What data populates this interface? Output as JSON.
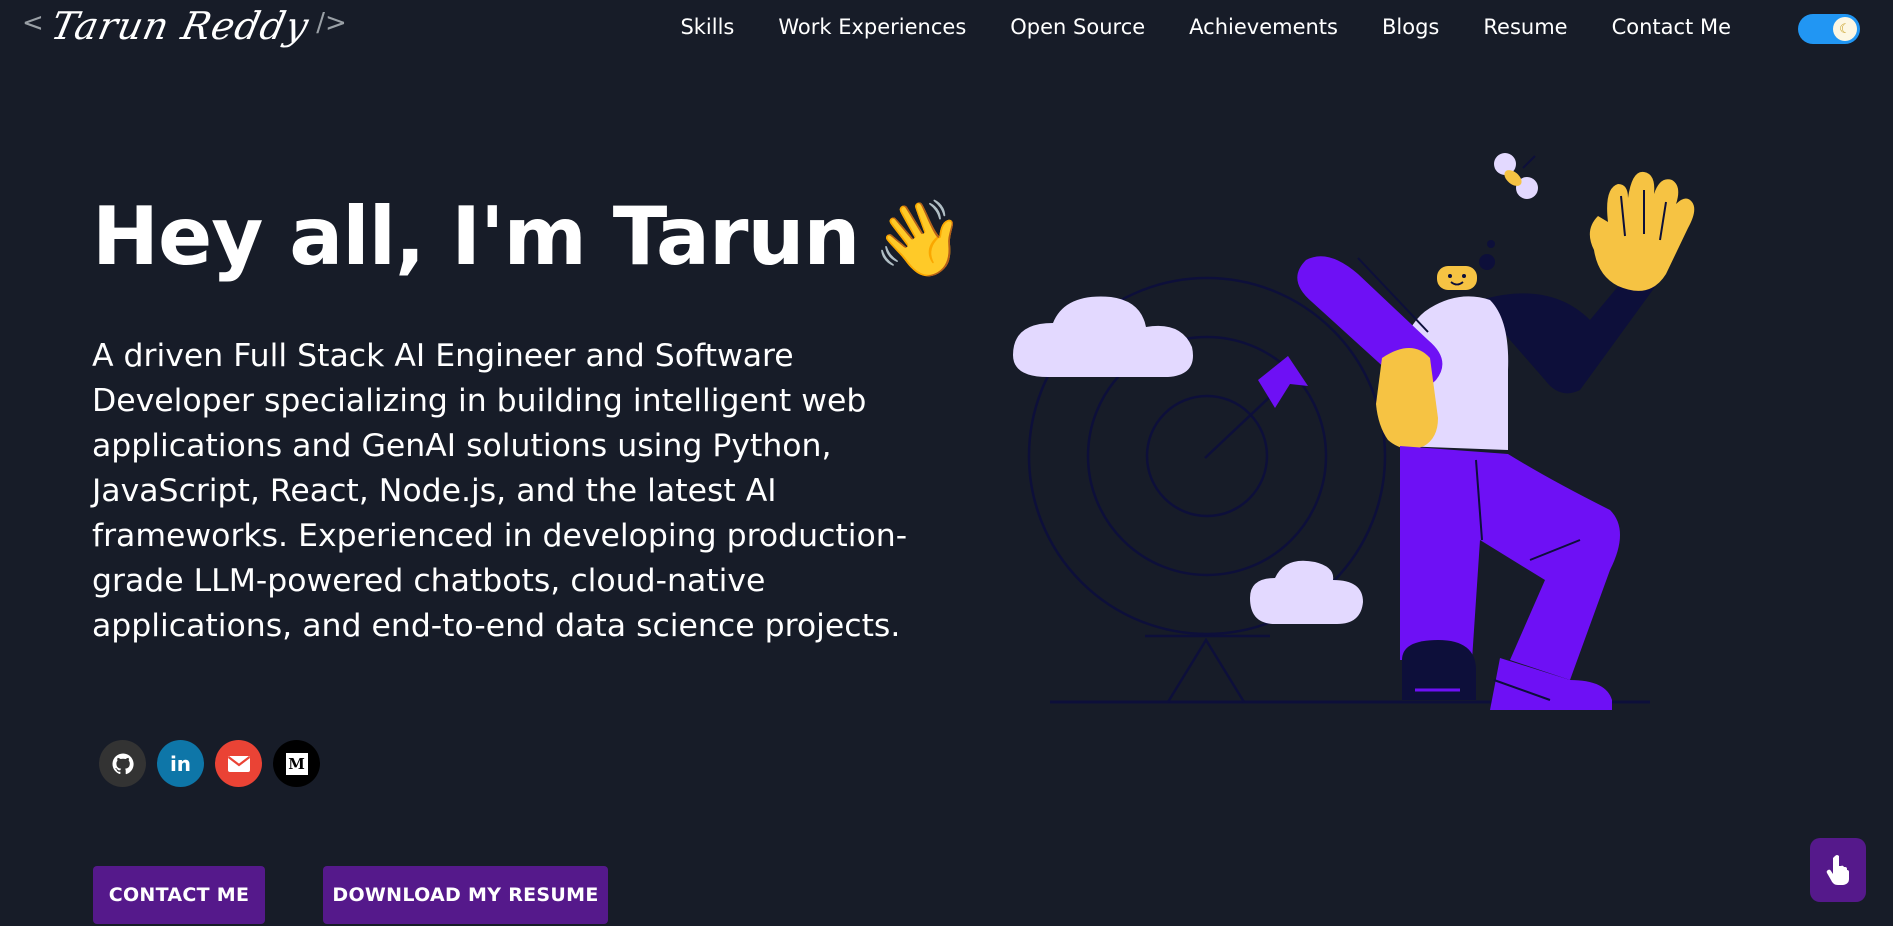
{
  "header": {
    "logo_open": "<",
    "logo_name": "Tarun Reddy",
    "logo_close": "/>",
    "nav": [
      {
        "label": "Skills"
      },
      {
        "label": "Work Experiences"
      },
      {
        "label": "Open Source"
      },
      {
        "label": "Achievements"
      },
      {
        "label": "Blogs"
      },
      {
        "label": "Resume"
      },
      {
        "label": "Contact Me"
      }
    ],
    "theme_toggle_icon": "moon-icon"
  },
  "hero": {
    "title": "Hey all, I'm Tarun",
    "wave_emoji": "👋",
    "description": "A driven Full Stack AI Engineer and Software Developer specializing in building intelligent web applications and GenAI solutions using Python, JavaScript, React, Node.js, and the latest AI frameworks. Experienced in developing production-grade LLM-powered chatbots, cloud-native applications, and end-to-end data science projects."
  },
  "socials": [
    {
      "icon": "github-icon",
      "glyph": "",
      "color": "#333333"
    },
    {
      "icon": "linkedin-icon",
      "glyph": "in",
      "color": "#0e76a8"
    },
    {
      "icon": "gmail-icon",
      "glyph": "",
      "color": "#ea4335"
    },
    {
      "icon": "medium-icon",
      "glyph": "M",
      "color": "#000000"
    }
  ],
  "buttons": {
    "contact": "CONTACT ME",
    "resume": "DOWNLOAD MY RESUME"
  },
  "colors": {
    "background": "#171c28",
    "accent_purple": "#55198b",
    "illustration_purple": "#6e10f5",
    "toggle_blue": "#2196f3"
  }
}
